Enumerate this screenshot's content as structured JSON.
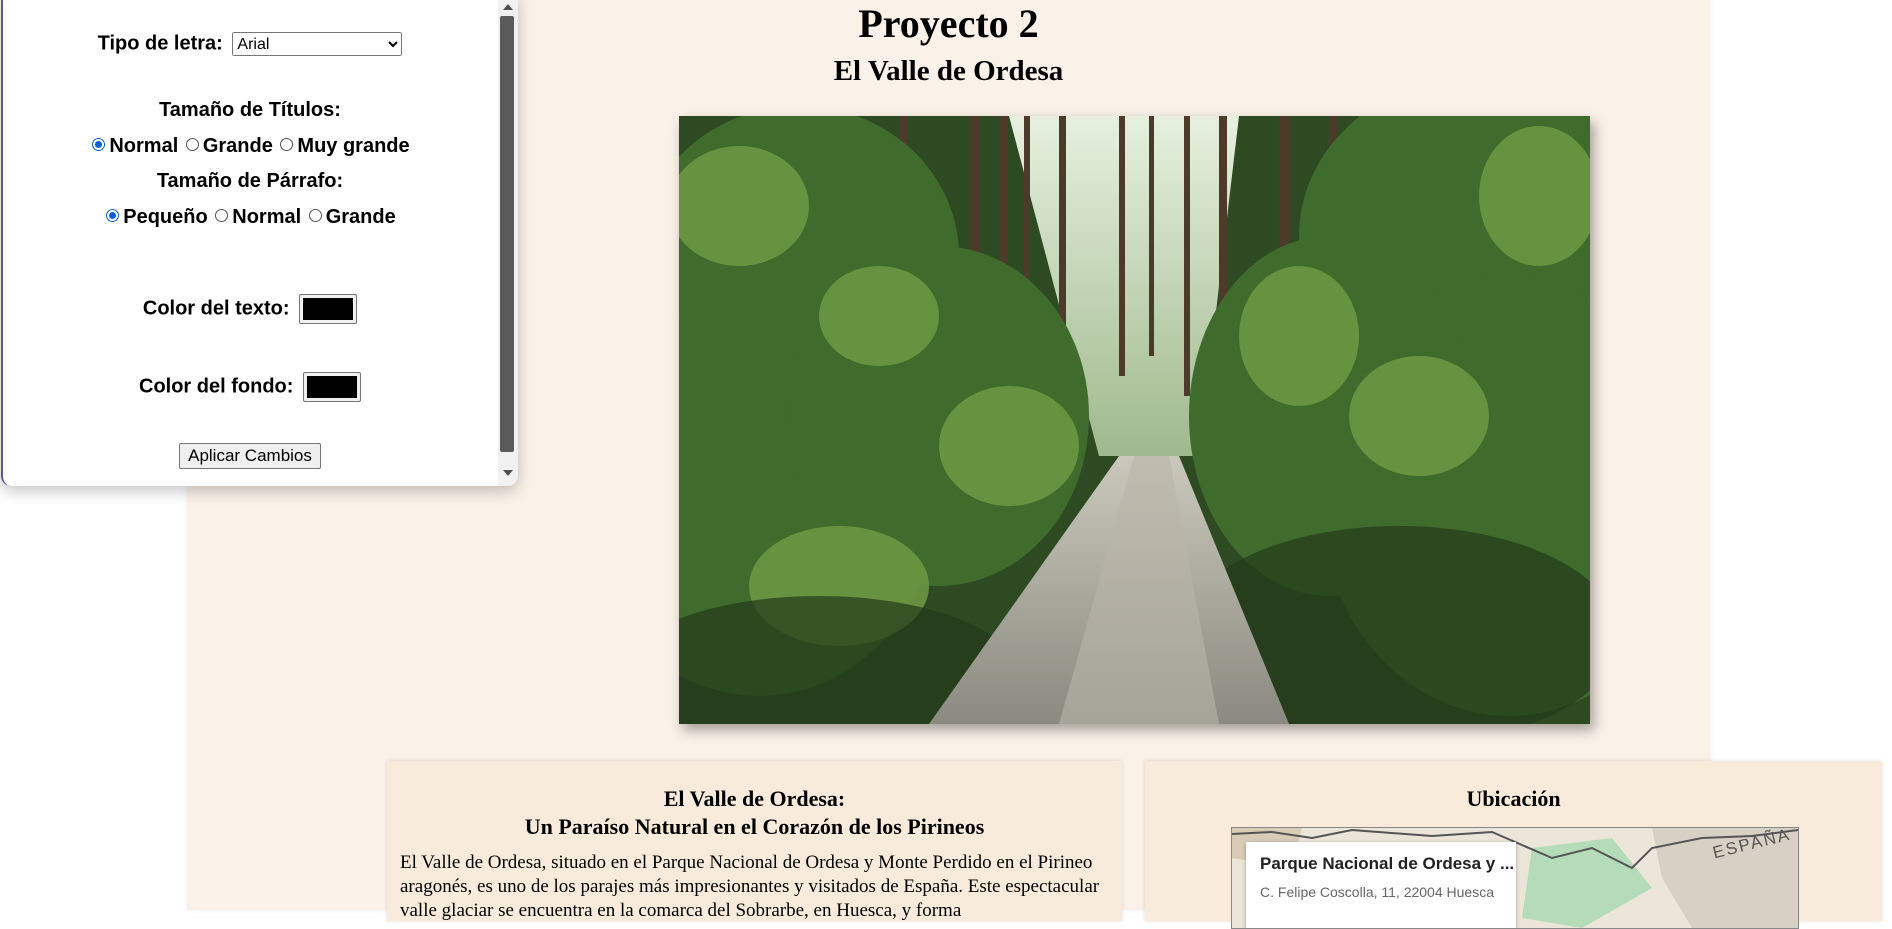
{
  "page": {
    "title": "Proyecto 2",
    "subtitle": "El Valle de Ordesa"
  },
  "article": {
    "heading_line1": "El Valle de Ordesa:",
    "heading_line2": "Un Paraíso Natural en el Corazón de los Pirineos",
    "body": "El Valle de Ordesa, situado en el Parque Nacional de Ordesa y Monte Perdido en el Pirineo aragonés, es uno de los parajes más impresionantes y visitados de España. Este espectacular valle glaciar se encuentra en la comarca del Sobrarbe, en Huesca, y forma"
  },
  "location": {
    "heading": "Ubicación",
    "map": {
      "place_name": "Parque Nacional de Ordesa y ...",
      "address": "C. Felipe Coscolla, 11, 22004 Huesca",
      "region_label": "ESPAÑA"
    }
  },
  "settings": {
    "font_label": "Tipo de letra:",
    "font_selected": "Arial",
    "title_size_label": "Tamaño de Títulos:",
    "title_size_options": [
      "Normal",
      "Grande",
      "Muy grande"
    ],
    "title_size_selected": "Normal",
    "paragraph_size_label": "Tamaño de Párrafo:",
    "paragraph_size_options": [
      "Pequeño",
      "Normal",
      "Grande"
    ],
    "paragraph_size_selected": "Pequeño",
    "text_color_label": "Color del texto:",
    "text_color_value": "#000000",
    "bg_color_label": "Color del fondo:",
    "bg_color_value": "#000000",
    "apply_label": "Aplicar Cambios"
  }
}
